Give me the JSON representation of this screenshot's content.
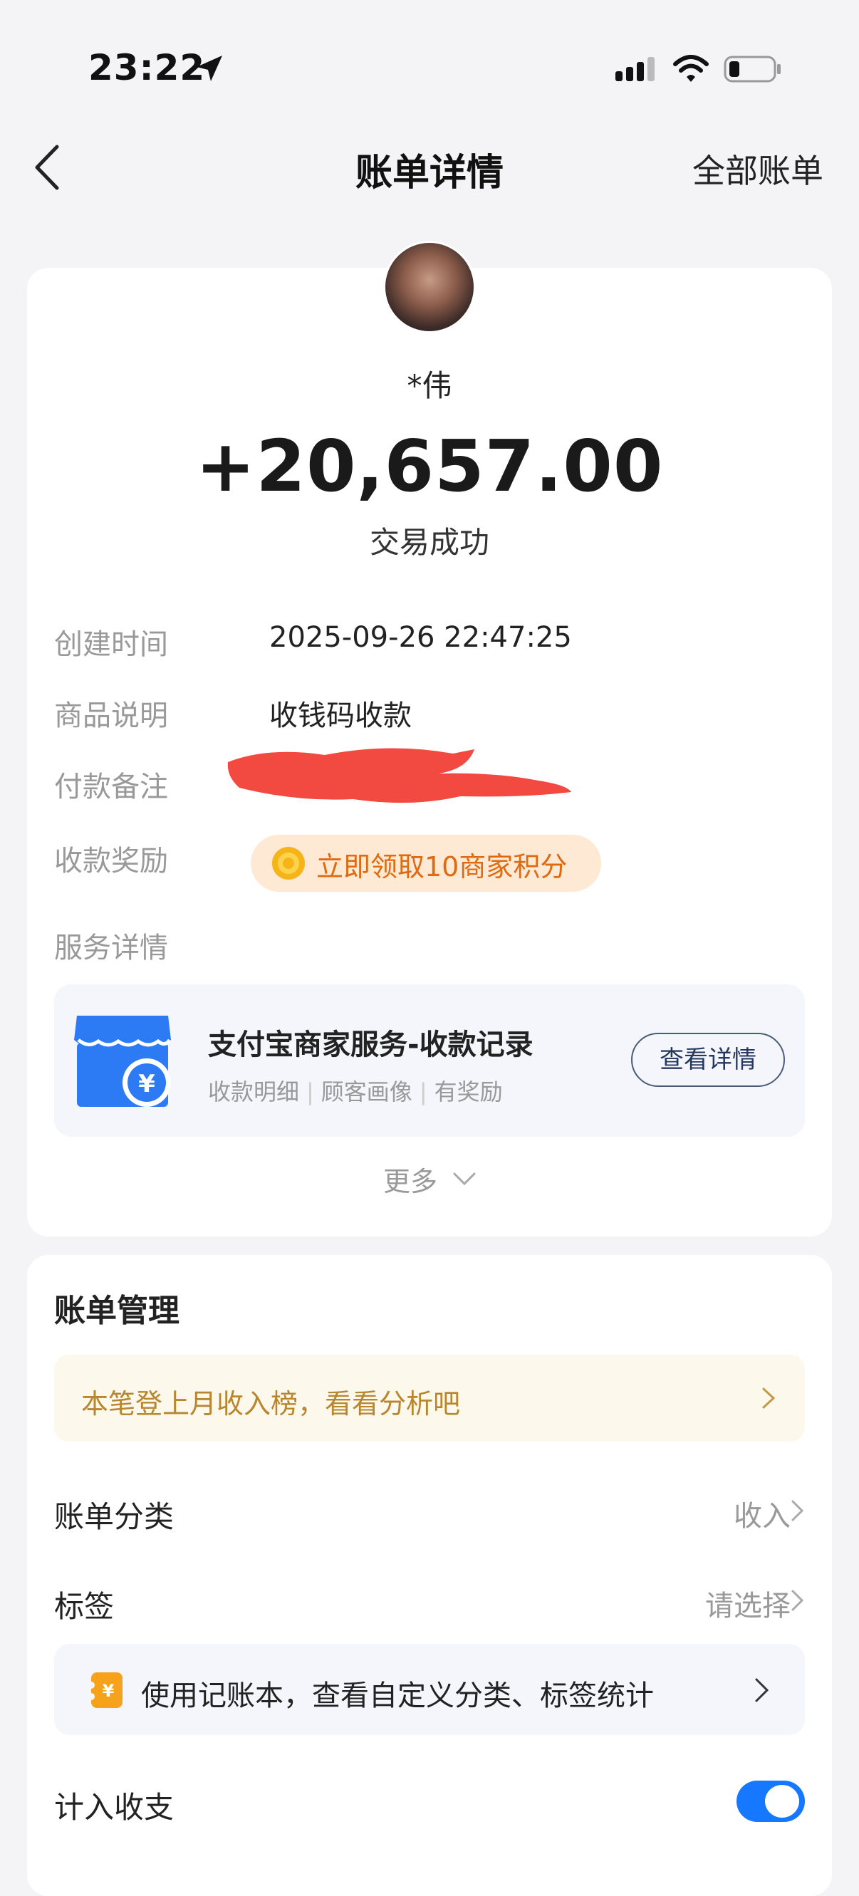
{
  "status_bar": {
    "time": "23:22"
  },
  "nav": {
    "title": "账单详情",
    "right_link": "全部账单"
  },
  "transaction": {
    "payer": "*伟",
    "amount": "+20,657.00",
    "status": "交易成功"
  },
  "details": {
    "created_label": "创建时间",
    "created_value": "2025-09-26 22:47:25",
    "product_label": "商品说明",
    "product_value": "收钱码收款",
    "remark_label": "付款备注",
    "reward_label": "收款奖励",
    "reward_text": "立即领取10商家积分",
    "service_label": "服务详情"
  },
  "service": {
    "title": "支付宝商家服务-收款记录",
    "tags": [
      "收款明细",
      "顾客画像",
      "有奖励"
    ],
    "button": "查看详情"
  },
  "more_label": "更多",
  "management": {
    "title": "账单管理",
    "banner": "本笔登上月收入榜，看看分析吧",
    "category_label": "账单分类",
    "category_value": "收入",
    "tag_label": "标签",
    "tag_value": "请选择",
    "ledger_text": "使用记账本，查看自定义分类、标签统计",
    "count_label": "计入收支",
    "count_enabled": true
  },
  "colors": {
    "accent_blue": "#1677ff",
    "reward_orange": "#e06a10",
    "banner_gold": "#b8862f"
  }
}
